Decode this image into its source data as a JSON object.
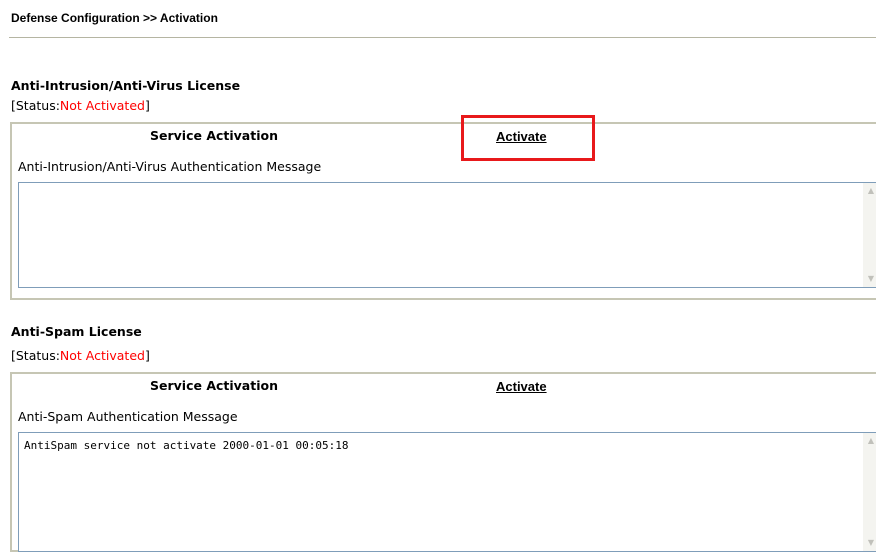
{
  "breadcrumb": "Defense Configuration >> Activation",
  "sections": [
    {
      "title": "Anti-Intrusion/Anti-Virus License",
      "status_prefix": "[Status:",
      "status_value": "Not Activated",
      "status_suffix": "]",
      "service_label": "Service Activation",
      "activate_label": "Activate",
      "message_label": "Anti-Intrusion/Anti-Virus Authentication Message",
      "message_text": ""
    },
    {
      "title": "Anti-Spam License",
      "status_prefix": "[Status:",
      "status_value": "Not Activated",
      "status_suffix": "]",
      "service_label": "Service Activation",
      "activate_label": "Activate",
      "message_label": "Anti-Spam Authentication Message",
      "message_text": "AntiSpam service not activate 2000-01-01 00:05:18"
    }
  ],
  "icons": {
    "scroll_up": "▲",
    "scroll_down": "▼"
  },
  "colors": {
    "status_not_activated": "#ff0000",
    "highlight": "#e8191b"
  }
}
